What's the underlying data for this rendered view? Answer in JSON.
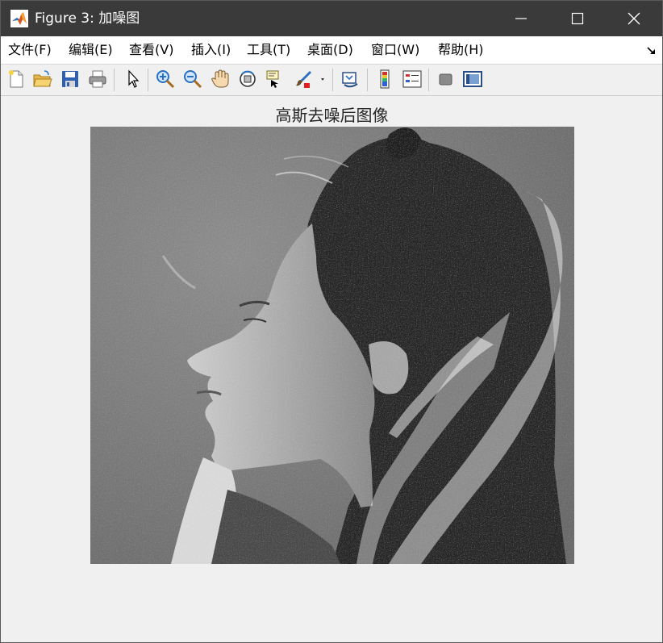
{
  "window": {
    "title": "Figure 3: 加噪图"
  },
  "menu": {
    "items": [
      {
        "label": "文件(F)"
      },
      {
        "label": "编辑(E)"
      },
      {
        "label": "查看(V)"
      },
      {
        "label": "插入(I)"
      },
      {
        "label": "工具(T)"
      },
      {
        "label": "桌面(D)"
      },
      {
        "label": "窗口(W)"
      },
      {
        "label": "帮助(H)"
      }
    ]
  },
  "toolbar": {
    "icons": [
      "new-figure-icon",
      "open-file-icon",
      "save-icon",
      "print-icon",
      "pointer-icon",
      "zoom-in-icon",
      "zoom-out-icon",
      "pan-hand-icon",
      "rotate-3d-icon",
      "data-cursor-icon",
      "brush-icon",
      "link-plot-icon",
      "colorbar-icon",
      "legend-icon",
      "hide-plot-tools-icon",
      "show-plot-tools-icon"
    ]
  },
  "axes": {
    "title": "高斯去噪后图像"
  },
  "colors": {
    "titlebar_bg": "#3a3a3a",
    "window_bg": "#f0f0f0",
    "menubar_bg": "#ffffff",
    "image_mode": "grayscale"
  }
}
